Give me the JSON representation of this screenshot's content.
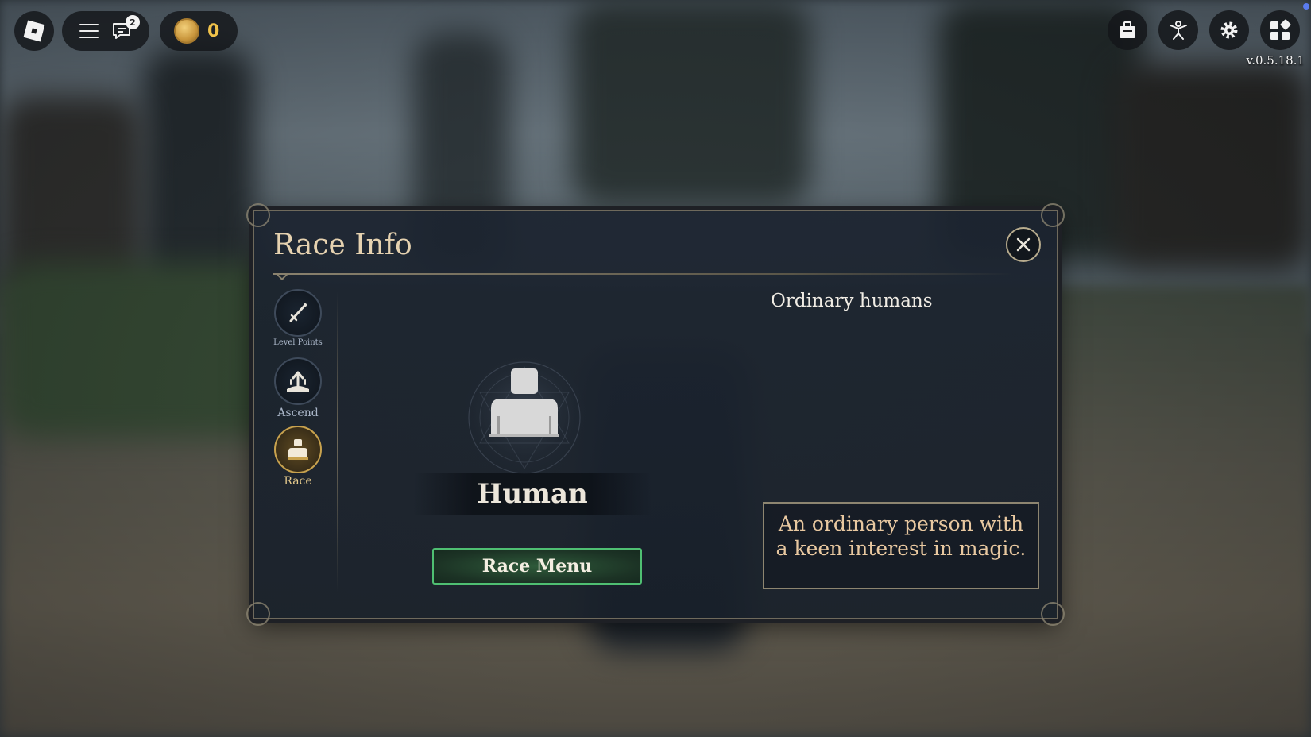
{
  "hud": {
    "chat_badge": "2",
    "coin_count": "0",
    "version": "v.0.5.18.1"
  },
  "modal": {
    "title": "Race Info",
    "nav": [
      {
        "label": "Level Points",
        "icon": "sword-icon"
      },
      {
        "label": "Ascend",
        "icon": "ascend-icon"
      },
      {
        "label": "Race",
        "icon": "race-icon",
        "active": true
      }
    ],
    "race_name": "Human",
    "race_subtitle": "Ordinary humans",
    "race_menu_label": "Race Menu",
    "description": "An ordinary person with a keen interest in magic."
  },
  "colors": {
    "title": "#e6d2b0",
    "accent_gold": "#c8a24e",
    "button_border": "#4fbf72",
    "coin_text": "#f0c24a",
    "description_text": "#e8c8a0"
  }
}
